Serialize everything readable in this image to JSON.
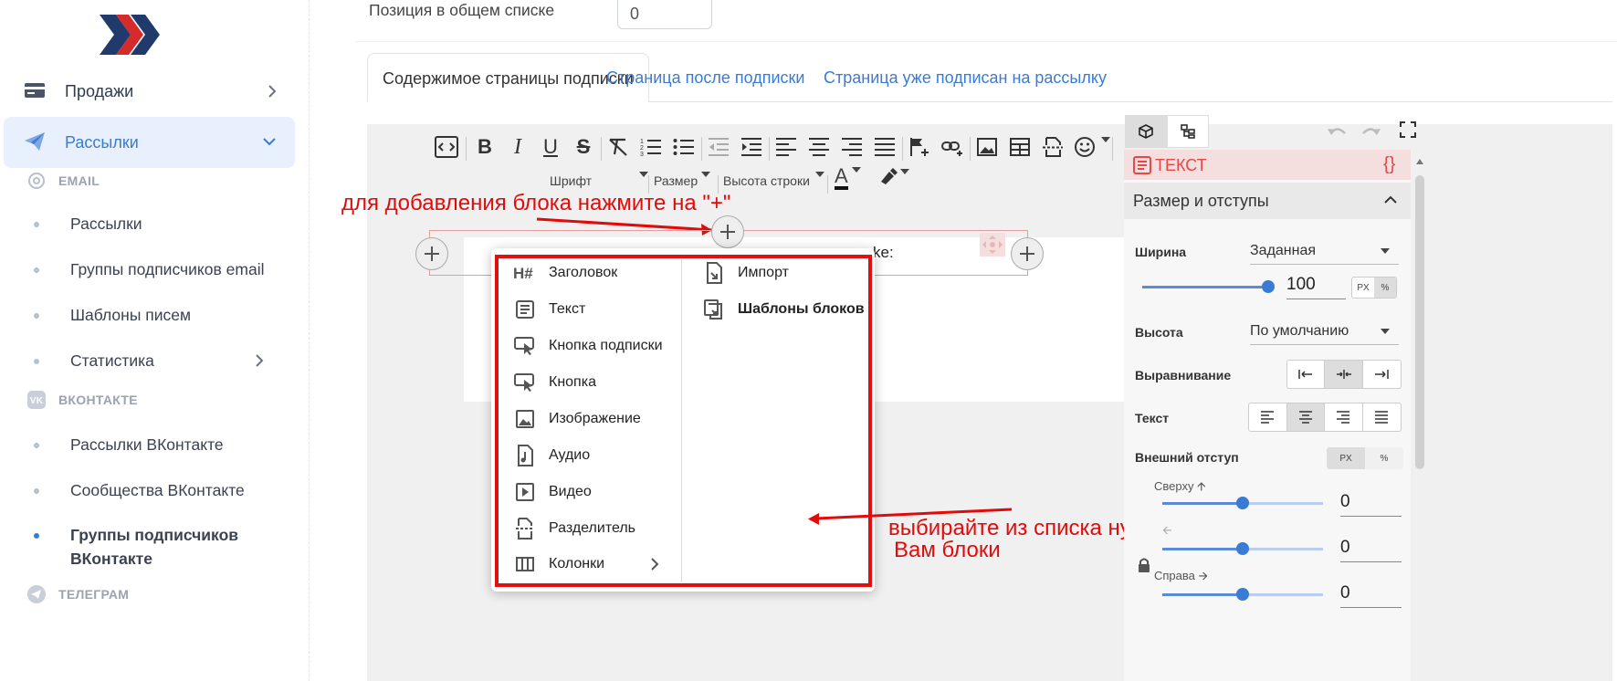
{
  "sidebar": {
    "main_items": [
      {
        "label": "Продажи",
        "icon": "card-icon"
      },
      {
        "label": "Рассылки",
        "icon": "paper-plane-icon"
      }
    ],
    "sections": {
      "email": "EMAIL",
      "vk": "ВКОНТАКТЕ",
      "telegram": "ТЕЛЕГРАМ"
    },
    "email_items": [
      "Рассылки",
      "Группы подписчиков email",
      "Шаблоны писем",
      "Статистика"
    ],
    "vk_items": [
      "Рассылки ВКонтакте",
      "Сообщества ВКонтакте",
      "Группы подписчиков ВКонтакте"
    ]
  },
  "position": {
    "label": "Позиция в общем списке",
    "value": "0"
  },
  "tabs": [
    "Содержимое страницы подписки",
    "Страница после подписки",
    "Страница уже подписан на рассылку"
  ],
  "toolbar": {
    "font_label": "Шрифт",
    "size_label": "Размер",
    "line_height_label": "Высота строки",
    "text_color_glyph": "A"
  },
  "canvas": {
    "block_text_fragment": "ke:"
  },
  "annotations": {
    "top": "для добавления блока нажмите на \"+\"",
    "bottom_line1": "выбирайте из списка нужные",
    "bottom_line2": "Вам блоки"
  },
  "popup": {
    "left_items": [
      "Заголовок",
      "Текст",
      "Кнопка подписки",
      "Кнопка",
      "Изображение",
      "Аудио",
      "Видео",
      "Разделитель",
      "Колонки"
    ],
    "right_items": [
      "Импорт",
      "Шаблоны блоков"
    ]
  },
  "panel": {
    "section_tag": "ТЕКСТ",
    "section_tag_icon": "{}",
    "size_header": "Размер и отступы",
    "width_label": "Ширина",
    "width_mode": "Заданная",
    "width_value": "100",
    "width_units": [
      "PX",
      "%"
    ],
    "height_label": "Высота",
    "height_mode": "По умолчанию",
    "align_label": "Выравнивание",
    "text_label": "Текст",
    "margin_label": "Внешний отступ",
    "margin_units": [
      "PX",
      "%"
    ],
    "top_label": "Сверху",
    "top_value": "0",
    "left_value": "0",
    "right_label": "Справа",
    "right_value": "0",
    "width_slider_fraction": 1.0,
    "margin_sliders_fraction": 0.5
  },
  "colors": {
    "accent": "#3a7bd5",
    "annotation": "#e20b0b",
    "brand_dark": "#1f3a6b",
    "brand_red": "#d62b2b"
  }
}
